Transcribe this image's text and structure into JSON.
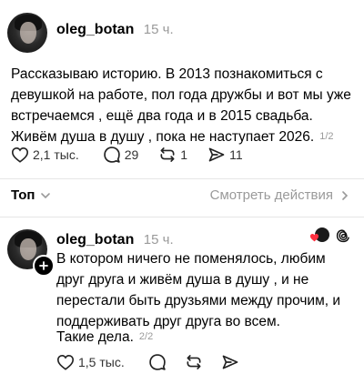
{
  "post1": {
    "username": "oleg_botan",
    "time": "15 ч.",
    "lines": [
      "Рассказываю историю. В 2013 познакомиться с",
      "девушкой на работе, пол года дружбы и вот мы уже",
      "встречаемся , ещё два года и в 2015 свадьба.",
      "Живём душа в душу , пока не наступает 2026."
    ],
    "pager": "1/2",
    "likes": "2,1 тыс.",
    "comments": "29",
    "reposts": "1",
    "shares": "11"
  },
  "sort": {
    "label": "Топ",
    "view_activity": "Смотреть действия"
  },
  "post2": {
    "username": "oleg_botan",
    "time": "15 ч.",
    "lines": [
      "В котором ничего не поменялось, любим",
      "друг друга и живём душа в душу , и не",
      "перестали быть друзьями между прочим, и",
      "поддерживать друг друга во всем."
    ],
    "extra": "Такие дела.",
    "pager": "2/2",
    "likes": "1,5 тыс."
  }
}
